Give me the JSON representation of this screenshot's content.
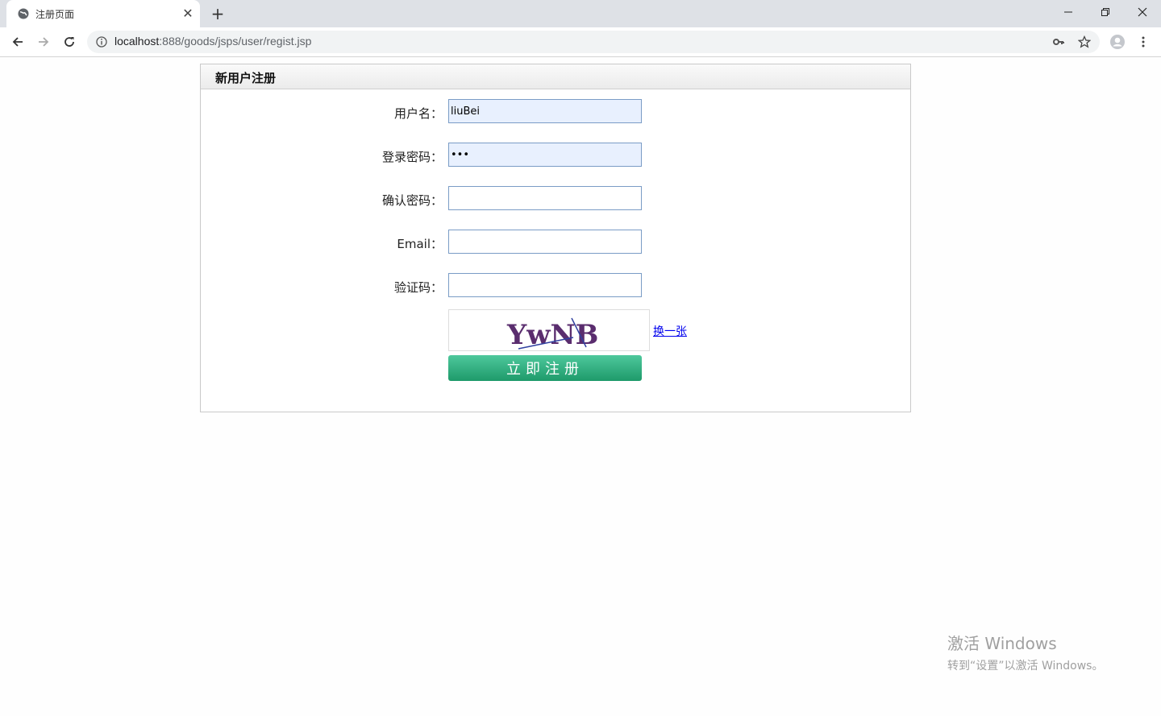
{
  "browser": {
    "tab_title": "注册页面",
    "url_host": "localhost",
    "url_rest": ":888/goods/jsps/user/regist.jsp",
    "icons": [
      "globe-icon",
      "close-icon",
      "plus-icon",
      "minimize-icon",
      "restore-icon",
      "close-window-icon",
      "back-icon",
      "forward-icon",
      "reload-icon",
      "info-icon",
      "key-icon",
      "star-icon",
      "avatar-icon",
      "menu-icon"
    ]
  },
  "form": {
    "title": "新用户注册",
    "username_label": "用户名：",
    "username_value": "liuBei",
    "password_label": "登录密码：",
    "password_value": "•••",
    "confirm_label": "确认密码：",
    "confirm_value": "",
    "email_label": "Email：",
    "email_value": "",
    "captcha_label": "验证码：",
    "captcha_value": "",
    "captcha_text": "YwNB",
    "captcha_refresh": "换一张",
    "submit_label": "立即注册",
    "accent_color": "#2aaa7a"
  },
  "watermark": {
    "line1": "激活 Windows",
    "line2": "转到“设置”以激活 Windows。"
  }
}
